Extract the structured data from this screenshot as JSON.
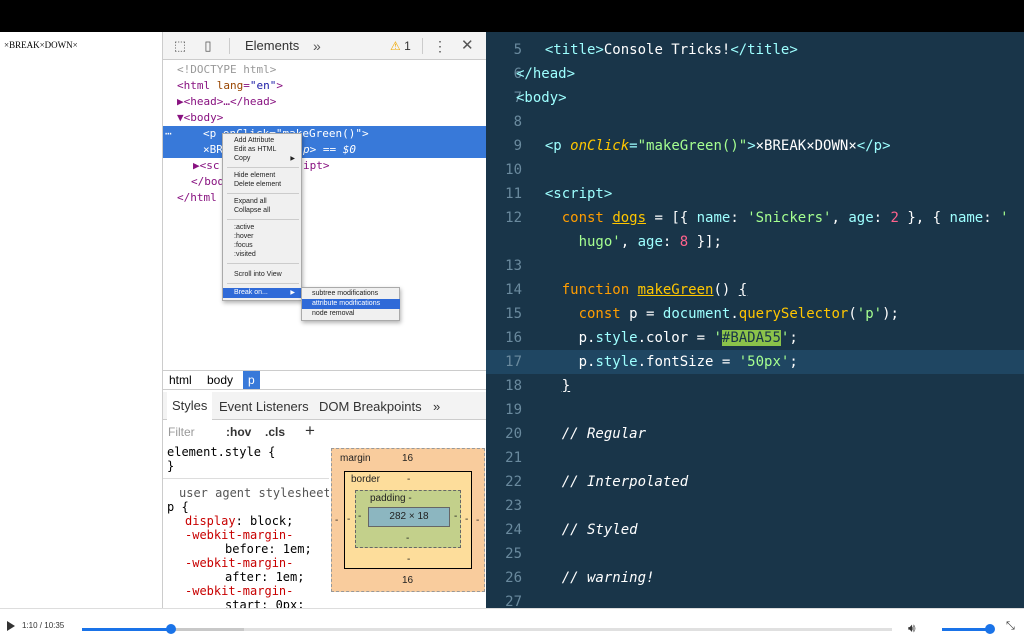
{
  "page": {
    "text": "×BREAK×DOWN×"
  },
  "devtools": {
    "tab_elements": "Elements",
    "more_tabs": "»",
    "warning_count": "1",
    "kebab": "⋮",
    "close": "✕",
    "dom_lines": [
      "<!DOCTYPE html>",
      "<html lang=\"en\">",
      "▶<head>…</head>",
      "▼<body>",
      "<p onClick=\"makeGreen()\">",
      "×BR",
      "p> == $0",
      "▶<sc",
      "ipt>",
      "</bod",
      "</html"
    ],
    "context_menu": {
      "items": [
        "Add Attribute",
        "Edit as HTML",
        "Copy",
        "Hide element",
        "Delete element",
        "Expand all",
        "Collapse all",
        ":active",
        ":hover",
        ":focus",
        ":visited",
        "Scroll into View",
        "Break on..."
      ],
      "submenu": [
        "subtree modifications",
        "attribute modifications",
        "node removal"
      ]
    },
    "breadcrumbs": [
      "html",
      "body",
      "p"
    ],
    "styles_tabs": [
      "Styles",
      "Event Listeners",
      "DOM Breakpoints",
      "»"
    ],
    "filter_placeholder": "Filter",
    "hov": ":hov",
    "cls": ".cls",
    "add": "+",
    "rules": {
      "element_style": "element.style {",
      "close_brace": "}",
      "ua_label": "user agent stylesheet",
      "selector": "p {",
      "props": [
        {
          "name": "display",
          "value": "block;"
        },
        {
          "name": "-webkit-margin-",
          "value": ""
        },
        {
          "name": "",
          "value": "before: 1em;"
        },
        {
          "name": "-webkit-margin-",
          "value": ""
        },
        {
          "name": "",
          "value": "after: 1em;"
        },
        {
          "name": "-webkit-margin-",
          "value": ""
        },
        {
          "name": "",
          "value": "start: 0px;"
        }
      ]
    },
    "box_model": {
      "margin_label": "margin",
      "margin_top": "16",
      "margin_bottom": "16",
      "margin_side": "-",
      "border_label": "border",
      "border_top": "-",
      "border_bottom": "-",
      "border_side": "-",
      "padding_label": "padding -",
      "padding_bottom": "-",
      "padding_side": "-",
      "content": "282 × 18"
    }
  },
  "editor": {
    "lines": [
      {
        "num": "5",
        "code": "  <title>Console Tricks!</title>"
      },
      {
        "num": "6",
        "code": "</head>"
      },
      {
        "num": "7",
        "code": "<body>"
      },
      {
        "num": "8",
        "code": ""
      },
      {
        "num": "9",
        "code": "  <p onClick=\"makeGreen()\">×BREAK×DOWN×</p>"
      },
      {
        "num": "10",
        "code": ""
      },
      {
        "num": "11",
        "code": "  <script>"
      },
      {
        "num": "12",
        "code": "    const dogs = [{ name: 'Snickers', age: 2 }, { name: '"
      },
      {
        "num": "",
        "code": "      hugo', age: 8 }];"
      },
      {
        "num": "13",
        "code": ""
      },
      {
        "num": "14",
        "code": "    function makeGreen() {"
      },
      {
        "num": "15",
        "code": "      const p = document.querySelector('p');"
      },
      {
        "num": "16",
        "code": "      p.style.color = '#BADA55';"
      },
      {
        "num": "17",
        "code": "      p.style.fontSize = '50px';"
      },
      {
        "num": "18",
        "code": "    }"
      },
      {
        "num": "19",
        "code": ""
      },
      {
        "num": "20",
        "code": "    // Regular"
      },
      {
        "num": "21",
        "code": ""
      },
      {
        "num": "22",
        "code": "    // Interpolated"
      },
      {
        "num": "23",
        "code": ""
      },
      {
        "num": "24",
        "code": "    // Styled"
      },
      {
        "num": "25",
        "code": ""
      },
      {
        "num": "26",
        "code": "    // warning!"
      },
      {
        "num": "27",
        "code": ""
      }
    ]
  },
  "player": {
    "time": "1:10 / 10:35",
    "progress_fraction": 0.11,
    "buffered_fraction": 0.2,
    "volume_fraction": 1.0
  },
  "colors": {
    "editor_bg": "#193549",
    "selection_blue": "#3879d9",
    "accent": "#1a73e8"
  }
}
